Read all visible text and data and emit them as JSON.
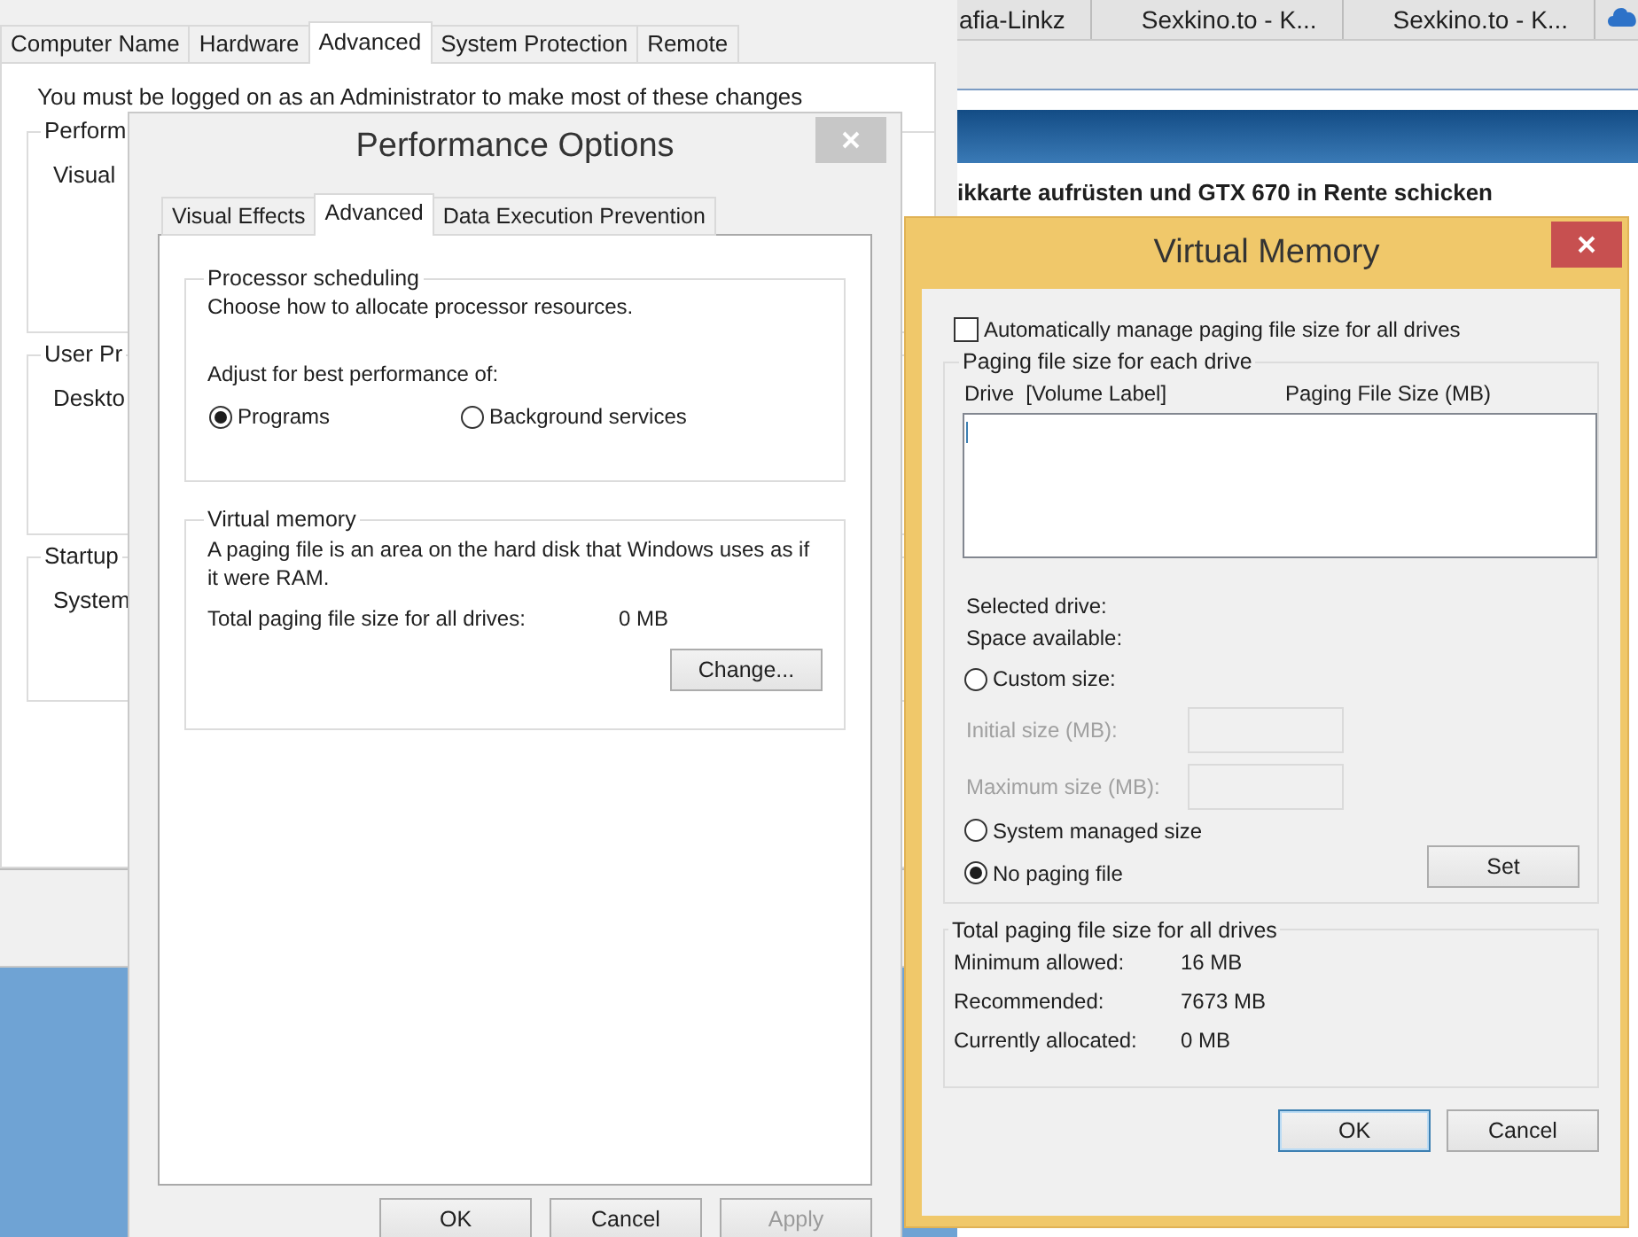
{
  "system_properties": {
    "tabs": [
      {
        "label": "Computer Name",
        "selected": false
      },
      {
        "label": "Hardware",
        "selected": false
      },
      {
        "label": "Advanced",
        "selected": true
      },
      {
        "label": "System Protection",
        "selected": false
      },
      {
        "label": "Remote",
        "selected": false
      }
    ],
    "notice": "You must be logged on as an Administrator to make most of these changes",
    "groups": [
      {
        "title": "Perform",
        "text": "Visual"
      },
      {
        "title": "User Pr",
        "text": "Deskto"
      },
      {
        "title": "Startup",
        "text": "System"
      }
    ]
  },
  "browser": {
    "tabs": [
      {
        "label": "afia-Linkz"
      },
      {
        "label": "Sexkino.to - K..."
      },
      {
        "label": "Sexkino.to - K..."
      }
    ],
    "headline": "ikkarte aufrüsten und GTX 670 in Rente schicken"
  },
  "performance_options": {
    "title": "Performance Options",
    "tabs": [
      {
        "label": "Visual Effects",
        "selected": false
      },
      {
        "label": "Advanced",
        "selected": true
      },
      {
        "label": "Data Execution Prevention",
        "selected": false
      }
    ],
    "processor_scheduling": {
      "title": "Processor scheduling",
      "description": "Choose how to allocate processor resources.",
      "prompt": "Adjust for best performance of:",
      "options": [
        {
          "label": "Programs",
          "selected": true
        },
        {
          "label": "Background services",
          "selected": false
        }
      ]
    },
    "virtual_memory": {
      "title": "Virtual memory",
      "description": "A paging file is an area on the hard disk that Windows uses as if it were RAM.",
      "total_label": "Total paging file size for all drives:",
      "total_value": "0 MB",
      "button": "Change..."
    },
    "buttons": [
      {
        "label": "OK",
        "disabled": false
      },
      {
        "label": "Cancel",
        "disabled": false
      },
      {
        "label": "Apply",
        "disabled": true
      }
    ]
  },
  "virtual_memory": {
    "title": "Virtual Memory",
    "auto_manage": {
      "label": "Automatically manage paging file size for all drives",
      "checked": false
    },
    "per_drive": {
      "title": "Paging file size for each drive",
      "columns": [
        "Drive  [Volume Label]",
        "Paging File Size (MB)"
      ],
      "selected_drive_label": "Selected drive:",
      "space_available_label": "Space available:",
      "options": [
        {
          "label": "Custom size:",
          "selected": false
        },
        {
          "label": "System managed size",
          "selected": false
        },
        {
          "label": "No paging file",
          "selected": true
        }
      ],
      "size_fields": [
        {
          "label": "Initial size (MB):",
          "disabled": true
        },
        {
          "label": "Maximum size (MB):",
          "disabled": true
        }
      ],
      "set_button": "Set"
    },
    "totals": {
      "title": "Total paging file size for all drives",
      "rows": [
        {
          "label": "Minimum allowed:",
          "value": "16 MB"
        },
        {
          "label": "Recommended:",
          "value": "7673 MB"
        },
        {
          "label": "Currently allocated:",
          "value": "0 MB"
        }
      ]
    },
    "buttons": [
      {
        "label": "OK",
        "default": true
      },
      {
        "label": "Cancel",
        "default": false
      }
    ]
  }
}
